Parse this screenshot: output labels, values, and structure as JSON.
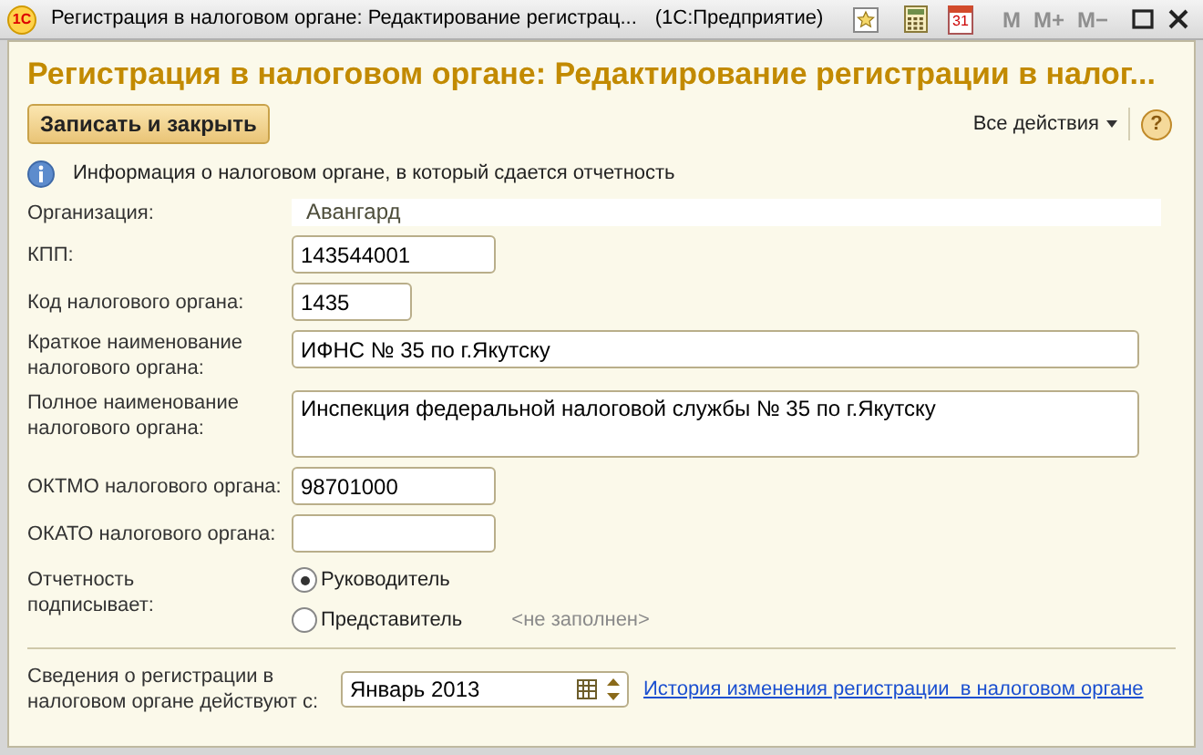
{
  "window": {
    "logo": "1С",
    "title": "Регистрация в налоговом органе: Редактирование регистрац...",
    "app": "(1С:Предприятие)",
    "calendar_day": "31",
    "memory_buttons": [
      {
        "label": "M",
        "disabled": true
      },
      {
        "label": "M+",
        "disabled": true
      },
      {
        "label": "M−",
        "disabled": true
      }
    ]
  },
  "form": {
    "heading": "Регистрация в налоговом органе: Редактирование регистрации в налог...",
    "save_button": "Записать и закрыть",
    "all_actions": "Все действия",
    "help": "?",
    "info": "Информация о налоговом органе, в который сдается отчетность"
  },
  "fields": [
    {
      "kind": "static",
      "label": "Организация:",
      "value": "Авангард"
    },
    {
      "kind": "medium",
      "label": "КПП:",
      "value": "143544001"
    },
    {
      "kind": "short",
      "label": "Код налогового органа:",
      "value": "1435"
    },
    {
      "kind": "wide",
      "label": "Краткое наименование налогового органа:",
      "value": "ИФНС № 35 по г.Якутску"
    },
    {
      "kind": "multiline",
      "label": "Полное наименование налогового органа:",
      "value": "Инспекция федеральной налоговой службы № 35 по г.Якутску"
    },
    {
      "kind": "medium",
      "label": "ОКТМО налогового органа:",
      "value": "98701000"
    },
    {
      "kind": "medium",
      "label": "ОКАТО налогового органа:"
    }
  ],
  "signer": {
    "label": "Отчетность подписывает:",
    "options": [
      {
        "label": "Руководитель",
        "selected": true
      },
      {
        "label": "Представитель",
        "selected": false,
        "note": "<не заполнен>"
      }
    ]
  },
  "period": {
    "label": "Сведения о регистрации в налоговом органе действуют с:",
    "value": "Январь 2013",
    "link": "История изменения регистрации  в налоговом органе"
  }
}
